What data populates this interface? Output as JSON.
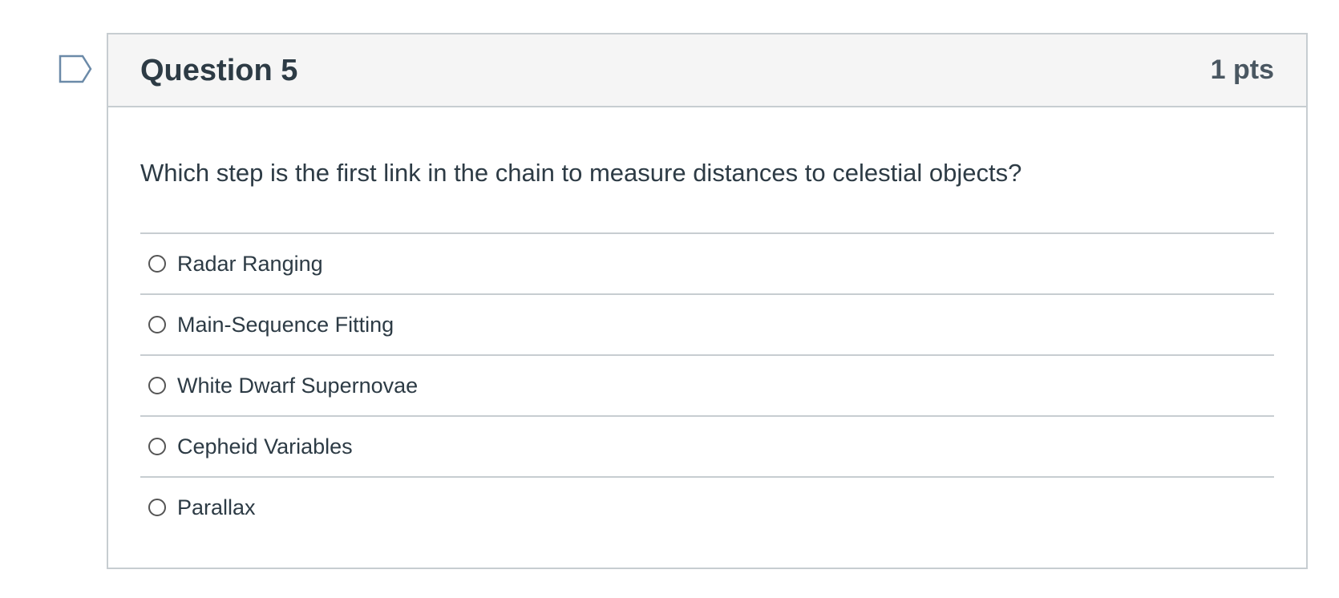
{
  "question": {
    "flag_icon": "flag-outline-icon",
    "title": "Question 5",
    "points": "1 pts",
    "text": "Which step is the first link in the chain to measure distances to celestial objects?",
    "answers": [
      {
        "label": "Radar Ranging",
        "selected": false
      },
      {
        "label": "Main-Sequence Fitting",
        "selected": false
      },
      {
        "label": "White Dwarf Supernovae",
        "selected": false
      },
      {
        "label": "Cepheid Variables",
        "selected": false
      },
      {
        "label": "Parallax",
        "selected": false
      }
    ]
  },
  "colors": {
    "header_background": "#f5f5f5",
    "border": "#c7cdd1",
    "text": "#2d3b45",
    "flag_outline": "#6b8aa8"
  }
}
